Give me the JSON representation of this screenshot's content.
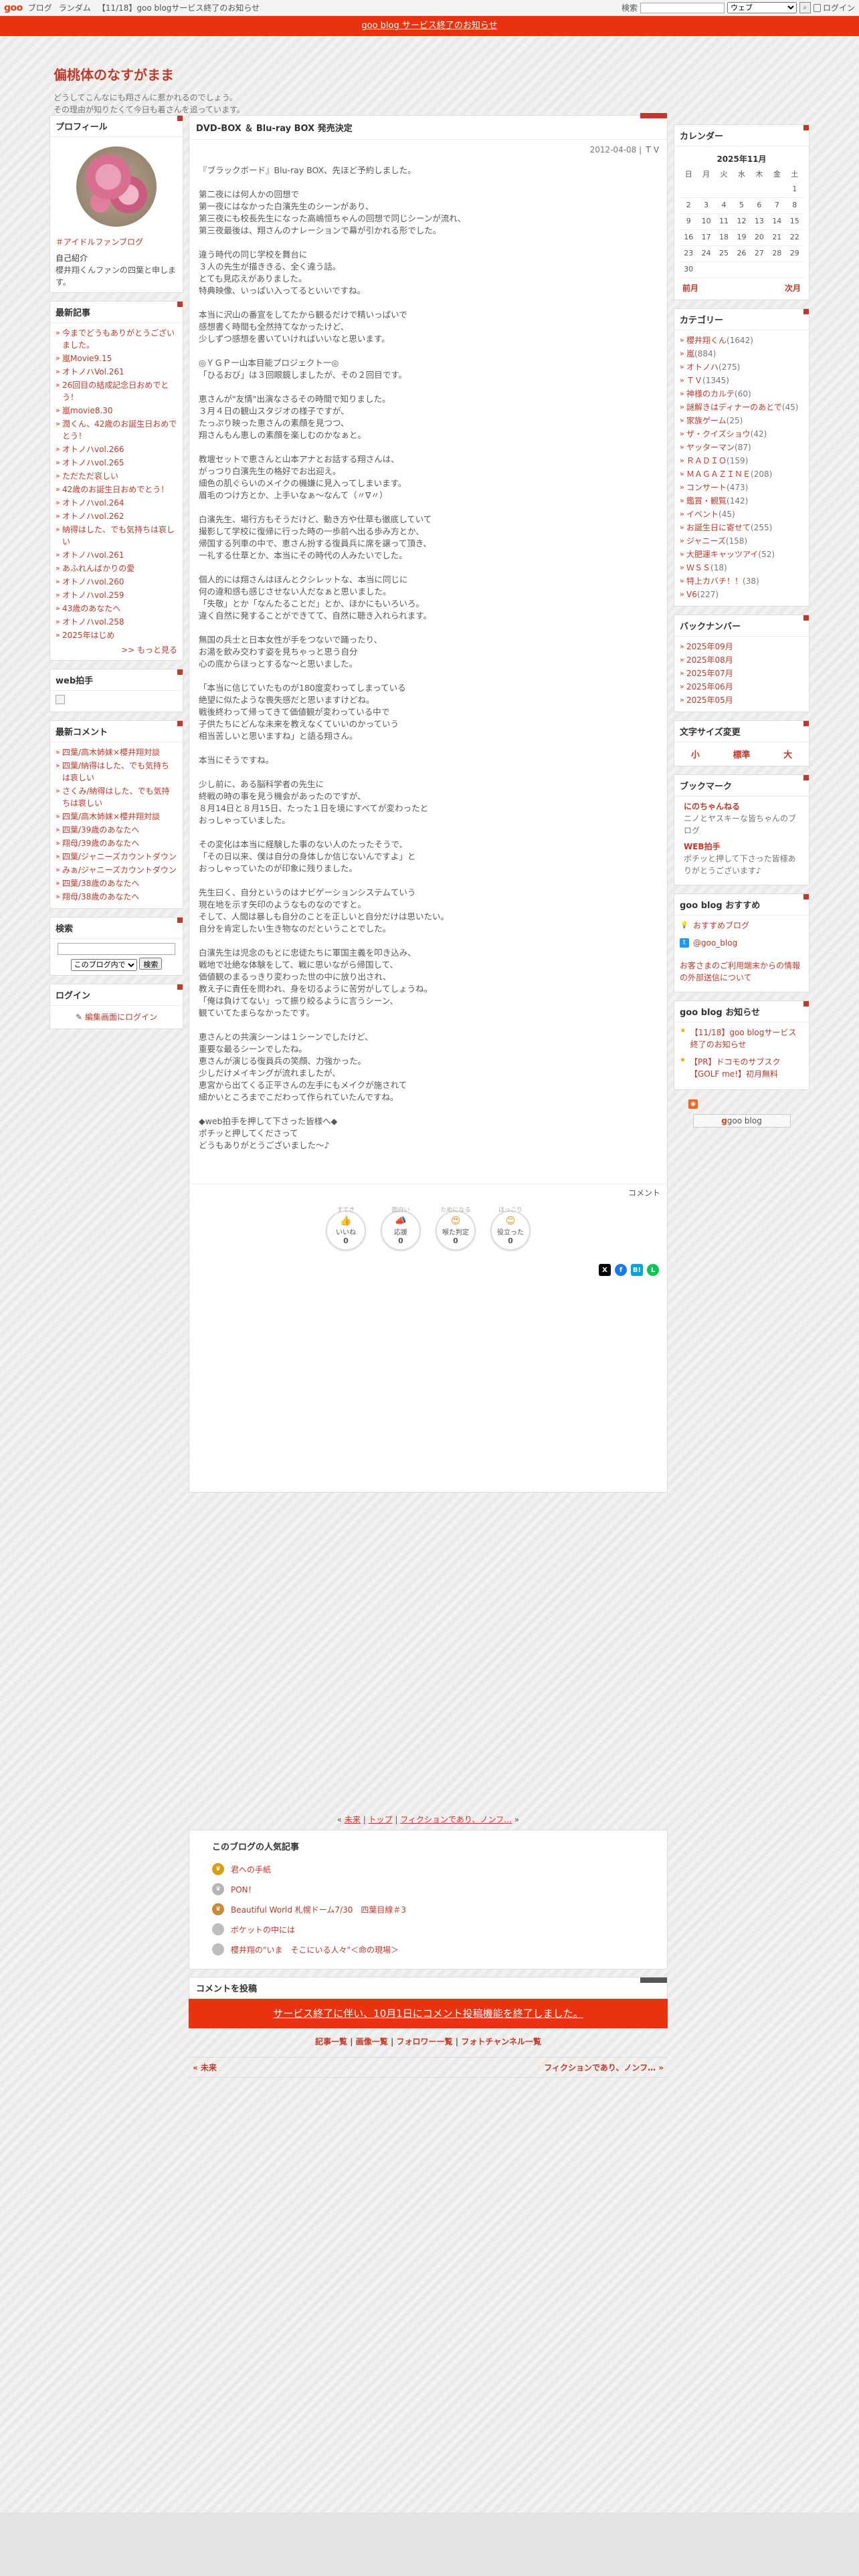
{
  "topbar": {
    "logo": "goo",
    "links": [
      "ブログ",
      "ランダム",
      "【11/18】goo blogサービス終了のお知らせ"
    ],
    "search_label": "検索",
    "search_placeholder": "",
    "search_scope": "ウェブ",
    "login": "ログイン"
  },
  "banner": {
    "text": "goo blog サービス終了のお知らせ"
  },
  "header": {
    "title": "偏桃体のなすがまま",
    "desc1": "どうしてこんなにも翔さんに惹かれるのでしょう。",
    "desc2": "その理由が知りたくて今日も着さんを追っています。"
  },
  "profile": {
    "title": "プロフィール",
    "tag": "＃アイドルファンブログ",
    "intro_label": "自己紹介",
    "intro": "櫻井翔くんファンの四葉と申します。"
  },
  "recent": {
    "title": "最新記事",
    "items": [
      "今までどうもありがとうございました。",
      "嵐Movie9.15",
      "オトノハVol.261",
      "26回目の結成記念日おめでとう！",
      "嵐movie8.30",
      "潤くん、42歳のお誕生日おめでとう！",
      "オトノハvol.266",
      "オトノハvol.265",
      "ただただ哀しい",
      "42歳のお誕生日おめでとう！",
      "オトノハvol.264",
      "オトノハvol.262",
      "納得はした、でも気持ちは哀しい",
      "オトノハvol.261",
      "あふれんばかりの愛",
      "オトノハvol.260",
      "オトノハvol.259",
      "43歳のあなたへ",
      "オトノハvol.258",
      "2025年はじめ"
    ],
    "more": ">> もっと見る"
  },
  "clap": {
    "title": "web拍手"
  },
  "recent_comments": {
    "title": "最新コメント",
    "items": [
      "四葉/高木姉妹×櫻井翔対談",
      "四葉/納得はした、でも気持ちは哀しい",
      "さくみ/納得はした、でも気持ちは哀しい",
      "四葉/高木姉妹×櫻井翔対談",
      "四葉/39歳のあなたへ",
      "翔母/39歳のあなたへ",
      "四葉/ジャニーズカウントダウン",
      "みぁ/ジャニーズカウントダウン",
      "四葉/38歳のあなたへ",
      "翔母/38歳のあなたへ"
    ]
  },
  "search": {
    "title": "検索",
    "scope": "このブログ内で",
    "button": "検索"
  },
  "login": {
    "title": "ログイン",
    "link": "編集画面にログイン"
  },
  "article": {
    "title": "DVD-BOX ＆ Blu-ray BOX 発売決定",
    "date": "2012-04-08",
    "category": "ＴＶ",
    "paragraphs": [
      "『ブラックボード』Blu-ray BOX、先ほど予約しました。",
      "第二夜には何人かの回想で\n第一夜にはなかった白濱先生のシーンがあり、\n第三夜にも校長先生になった高嶋恒ちゃんの回想で同じシーンが流れ、\n第三夜最後は、翔さんのナレーションで幕が引かれる形でした。",
      "違う時代の同じ学校を舞台に\n３人の先生が描ききる、全く違う話。\nとても見応えがありました。\n特典映像、いっぱい入ってるといいですね。",
      "本当に沢山の番宣をしてたから観るだけで精いっぱいで\n感想書く時間も全然持てなかったけど、\n少しずつ感想を書いていければいいなと思います。",
      "◎ＹＧＰ一山本目能プロジェクト一◎\n「ひるおび」は３回眼鏡しましたが、その２回目です。",
      "恵さんが\"友情\"出演なさるその時間で知りました。\n３月４日の観山スタジオの様子ですが、\nたっぷり映った恵さんの素顔を見つつ、\n翔さんもん恵しの素顔を楽しむのかなぁと。",
      "教壇セットで恵さんと山本アナとお話する翔さんは、\nがっつり白濱先生の格好でお出迎え。\n細色の肌ぐらいのメイクの機嫌に見入ってしまいます。\n眉毛のつけ方とか、上手いなぁ〜なんて（〃∇〃）",
      "白濱先生、場行方もそうだけど、動き方や仕草も徹底していて\n撮影して学校に復帰に行った時の一歩前へ出る歩み方とか、\n帰国する列車の中で、恵さん扮する復員兵に席を譲って頂き、\n一礼する仕草とか、本当にその時代の人みたいでした。",
      "個人的には翔さんはほんとクシレットな、本当に同じに\n何の違和感も感じさせない人だなぁと思いました。\n「失敬」とか「なんたることだ」とか、ほかにもいろいろ。\n違く自然に発することができてて、自然に聴き入れられます。",
      "無国の兵士と日本女性が手をつないで踊ったり、\nお湯を飲み交わす姿を見ちゃっと思う自分\n心の底からほっとするな〜と思いました。",
      "「本当に信じていたものが180度変わってしまっている\n絶望に似たような喪失感だと思いますけどね。\n戦後終わって帰ってきて価値観が変わっている中で\n子供たちにどんな未来を教えなくていいのかっていう\n相当苦しいと思いますね」と語る翔さん。",
      "本当にそうですね。",
      "少し前に、ある脳科学者の先生に\n終戦の時の事を見う機会があったのですが、\n８月14日と８月15日、たった１日を境にすべてが変わったと\nおっしゃっていました。",
      "その変化は本当に経験した事のない人のたったそうで、\n「その日以来、僕は自分の身体しか信じないんですよ」と\nおっしゃっていたのが印象に残りました。",
      "先生曰く、自分というのはナビゲーションシステムていう\n現在地を示す矢印のようなものなのですと。\nそして、人間は暴しも自分のことを正しいと自分だけは思いたい。\n自分を肯定したい生き物なのだということでした。",
      "白濱先生は児念のもとに忠徒たちに軍国主義を叩き込み、\n戦地で壮絶な体験をして、戦に思いながら帰国して、\n価値観のまるっきり変わった世の中に放り出され、\n教え子に責任を問われ、身を切るように苦労がしてしょうね。\n「俺は負けてない」って振り絞るように言うシーン、\n観ていてたまらなかったです。",
      "恵さんとの共演シーンは１シーンでしたけど、\n重要な最るシーンでしたね。\n恵さんが演じる復員兵の笑顔、力強かった。\n少しだけメイキングが流れましたが、\n恵宮から出てくる正平さんの左手にもメイクが施されて\n細かいところまでこだわって作られていたんですね。",
      "◆web拍手を押して下さった皆様へ◆\nポチッと押してくださって\nどうもありがとうございました〜♪"
    ],
    "comment": "コメント",
    "reactions": [
      {
        "top": "すてき",
        "label": "いいね",
        "count": "0"
      },
      {
        "top": "面白い",
        "label": "応援",
        "count": "0"
      },
      {
        "top": "ためになる",
        "label": "喉た判定",
        "count": "0"
      },
      {
        "top": "ほっこり",
        "label": "役立った",
        "count": "0"
      }
    ]
  },
  "pager": {
    "prev": "未来",
    "top": "トップ",
    "next": "フィクションであり、ノンフ…"
  },
  "popular": {
    "title": "このブログの人気記事",
    "items": [
      "君への手紙",
      "PON！",
      "Beautiful World 札幌ドーム7/30　四葉目線＃3",
      "ボケットの中には",
      "櫻井翔の\"いま　そこにいる人々\"＜命の現場＞"
    ]
  },
  "comment_post": {
    "title": "コメントを投稿",
    "closed": "サービス終了に伴い、10月1日にコメント投稿機能を終了しました。"
  },
  "footer_links": [
    "記事一覧",
    "画像一覧",
    "フォロワー一覧",
    "フォトチャンネル一覧"
  ],
  "footer_nav": {
    "prev": "« 未来",
    "next": "フィクションであり、ノンフ… »"
  },
  "calendar": {
    "title": "カレンダー",
    "month": "2025年11月",
    "weekdays": [
      "日",
      "月",
      "火",
      "水",
      "木",
      "金",
      "土"
    ],
    "weeks": [
      [
        "",
        "",
        "",
        "",
        "",
        "",
        "1"
      ],
      [
        "2",
        "3",
        "4",
        "5",
        "6",
        "7",
        "8"
      ],
      [
        "9",
        "10",
        "11",
        "12",
        "13",
        "14",
        "15"
      ],
      [
        "16",
        "17",
        "18",
        "19",
        "20",
        "21",
        "22"
      ],
      [
        "23",
        "24",
        "25",
        "26",
        "27",
        "28",
        "29"
      ],
      [
        "30",
        "",
        "",
        "",
        "",
        "",
        ""
      ]
    ],
    "prev": "前月",
    "next": "次月"
  },
  "categories": {
    "title": "カテゴリー",
    "items": [
      {
        "name": "櫻井翔くん",
        "count": "(1642)"
      },
      {
        "name": "嵐",
        "count": "(884)"
      },
      {
        "name": "オトノハ",
        "count": "(275)"
      },
      {
        "name": "ＴＶ",
        "count": "(1345)"
      },
      {
        "name": "神様のカルテ",
        "count": "(60)"
      },
      {
        "name": "謎解きはディナーのあとで",
        "count": "(45)"
      },
      {
        "name": "家族ゲーム",
        "count": "(25)"
      },
      {
        "name": "ザ・クイズショウ",
        "count": "(42)"
      },
      {
        "name": "ヤッターマン",
        "count": "(87)"
      },
      {
        "name": "ＲＡＤＩＯ",
        "count": "(159)"
      },
      {
        "name": "ＭＡＧＡＺＩＮＥ",
        "count": "(208)"
      },
      {
        "name": "コンサート",
        "count": "(473)"
      },
      {
        "name": "鑑賞・観覧",
        "count": "(142)"
      },
      {
        "name": "イベント",
        "count": "(45)"
      },
      {
        "name": "お誕生日に寄せて",
        "count": "(255)"
      },
      {
        "name": "ジャニーズ",
        "count": "(158)"
      },
      {
        "name": "大肥運キャッツアイ",
        "count": "(52)"
      },
      {
        "name": "ＷＳＳ",
        "count": "(18)"
      },
      {
        "name": "特上カバチ！！",
        "count": "(38)"
      },
      {
        "name": "V6",
        "count": "(227)"
      }
    ]
  },
  "backnumber": {
    "title": "バックナンバー",
    "items": [
      "2025年09月",
      "2025年08月",
      "2025年07月",
      "2025年06月",
      "2025年05月"
    ]
  },
  "fontsize": {
    "title": "文字サイズ変更",
    "small": "小",
    "medium": "標準",
    "large": "大"
  },
  "bookmark": {
    "title": "ブックマーク",
    "items": [
      {
        "name": "にのちゃんねる",
        "desc": "ニノとヤスキーな皆ちゃんのブログ"
      },
      {
        "name": "WEB拍手",
        "desc": "ポチッと押して下さった皆様ありがとうございます♪"
      }
    ]
  },
  "recommend": {
    "title": "goo blog おすすめ",
    "items": [
      "おすすめブログ",
      "@goo_blog"
    ],
    "notice": "お客さまのご利用端末からの情報の外部送信について"
  },
  "news": {
    "title": "goo blog お知らせ",
    "items": [
      "【11/18】goo blogサービス終了のお知らせ",
      "【PR】ドコモのサブスク【GOLF me!】初月無料"
    ]
  },
  "rss": {
    "button": "goo blog"
  },
  "colors": {
    "accent": "#c0392b",
    "banner": "#e9320f"
  }
}
